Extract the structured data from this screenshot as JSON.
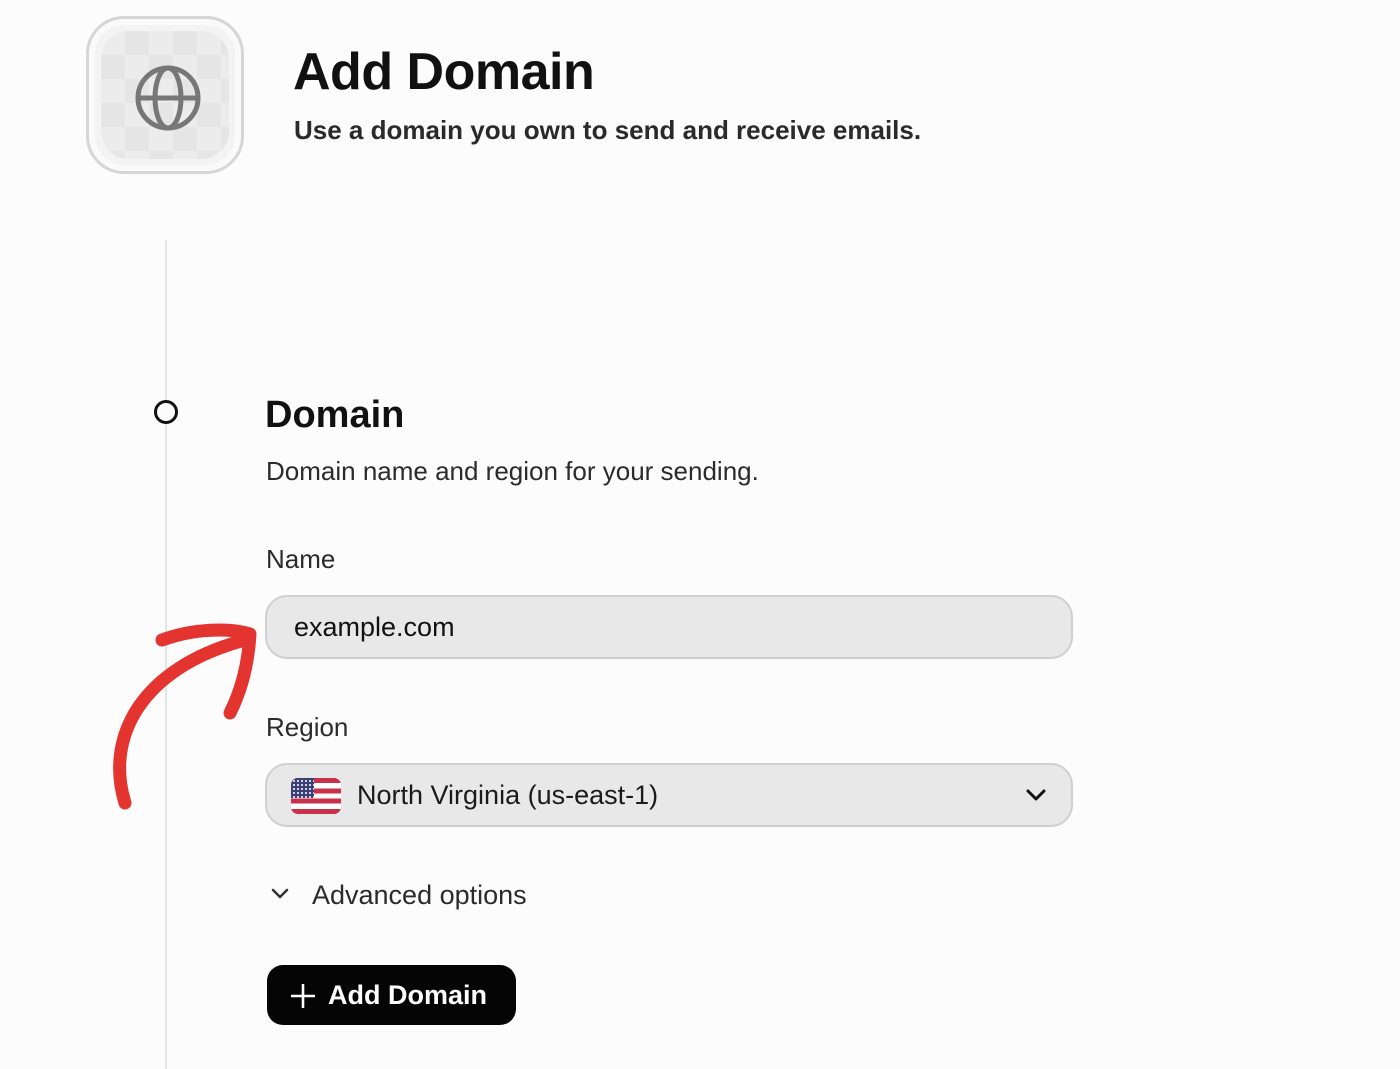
{
  "header": {
    "icon": "globe-icon",
    "title": "Add Domain",
    "subtitle": "Use a domain you own to send and receive emails."
  },
  "section": {
    "title": "Domain",
    "description": "Domain name and region for your sending."
  },
  "form": {
    "name_label": "Name",
    "name_value": "example.com",
    "region_label": "Region",
    "region_flag": "us-flag-icon",
    "region_value": "North Virginia (us-east-1)",
    "advanced_label": "Advanced options",
    "submit_label": "Add Domain"
  },
  "annotation": {
    "arrow_color": "#e3342f"
  },
  "colors": {
    "primary_button": "#050505",
    "field_background": "#e8e8e8"
  }
}
